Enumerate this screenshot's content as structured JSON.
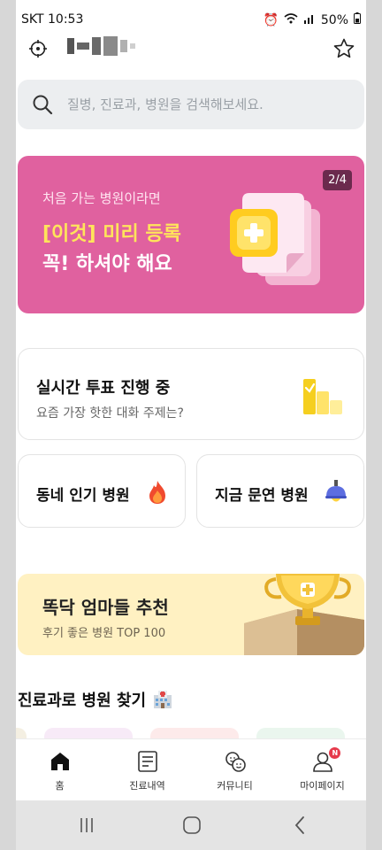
{
  "status": {
    "carrier": "SKT",
    "time": "10:53",
    "battery": "50%"
  },
  "search": {
    "placeholder": "질병, 진료과, 병원을 검색해보세요."
  },
  "banner": {
    "subtitle": "처음 가는 병원이라면",
    "highlight": "[이것] 미리 등록",
    "line2": "꼭! 하셔야 해요",
    "pager": "2/4",
    "colors": {
      "background": "#e0619f",
      "highlight": "#ffe55a"
    }
  },
  "vote_card": {
    "title": "실시간 투표 진행 중",
    "desc": "요즘 가장 핫한 대화 주제는?"
  },
  "popular_card": {
    "label": "동네 인기 병원"
  },
  "open_card": {
    "label": "지금 문연 병원"
  },
  "recommend_card": {
    "title": "똑닥 엄마들 추천",
    "desc": "후기 좋은 병원 TOP 100"
  },
  "section": {
    "title": "진료과로 병원 찾기"
  },
  "tabs": [
    {
      "label": "홈",
      "icon": "home-icon",
      "active": true
    },
    {
      "label": "진료내역",
      "icon": "document-icon",
      "active": false
    },
    {
      "label": "커뮤니티",
      "icon": "community-icon",
      "active": false
    },
    {
      "label": "마이페이지",
      "icon": "profile-icon",
      "active": false,
      "badge": "N"
    }
  ],
  "system_nav": {
    "items": [
      "recent-apps-icon",
      "home-button-icon",
      "back-icon"
    ]
  }
}
